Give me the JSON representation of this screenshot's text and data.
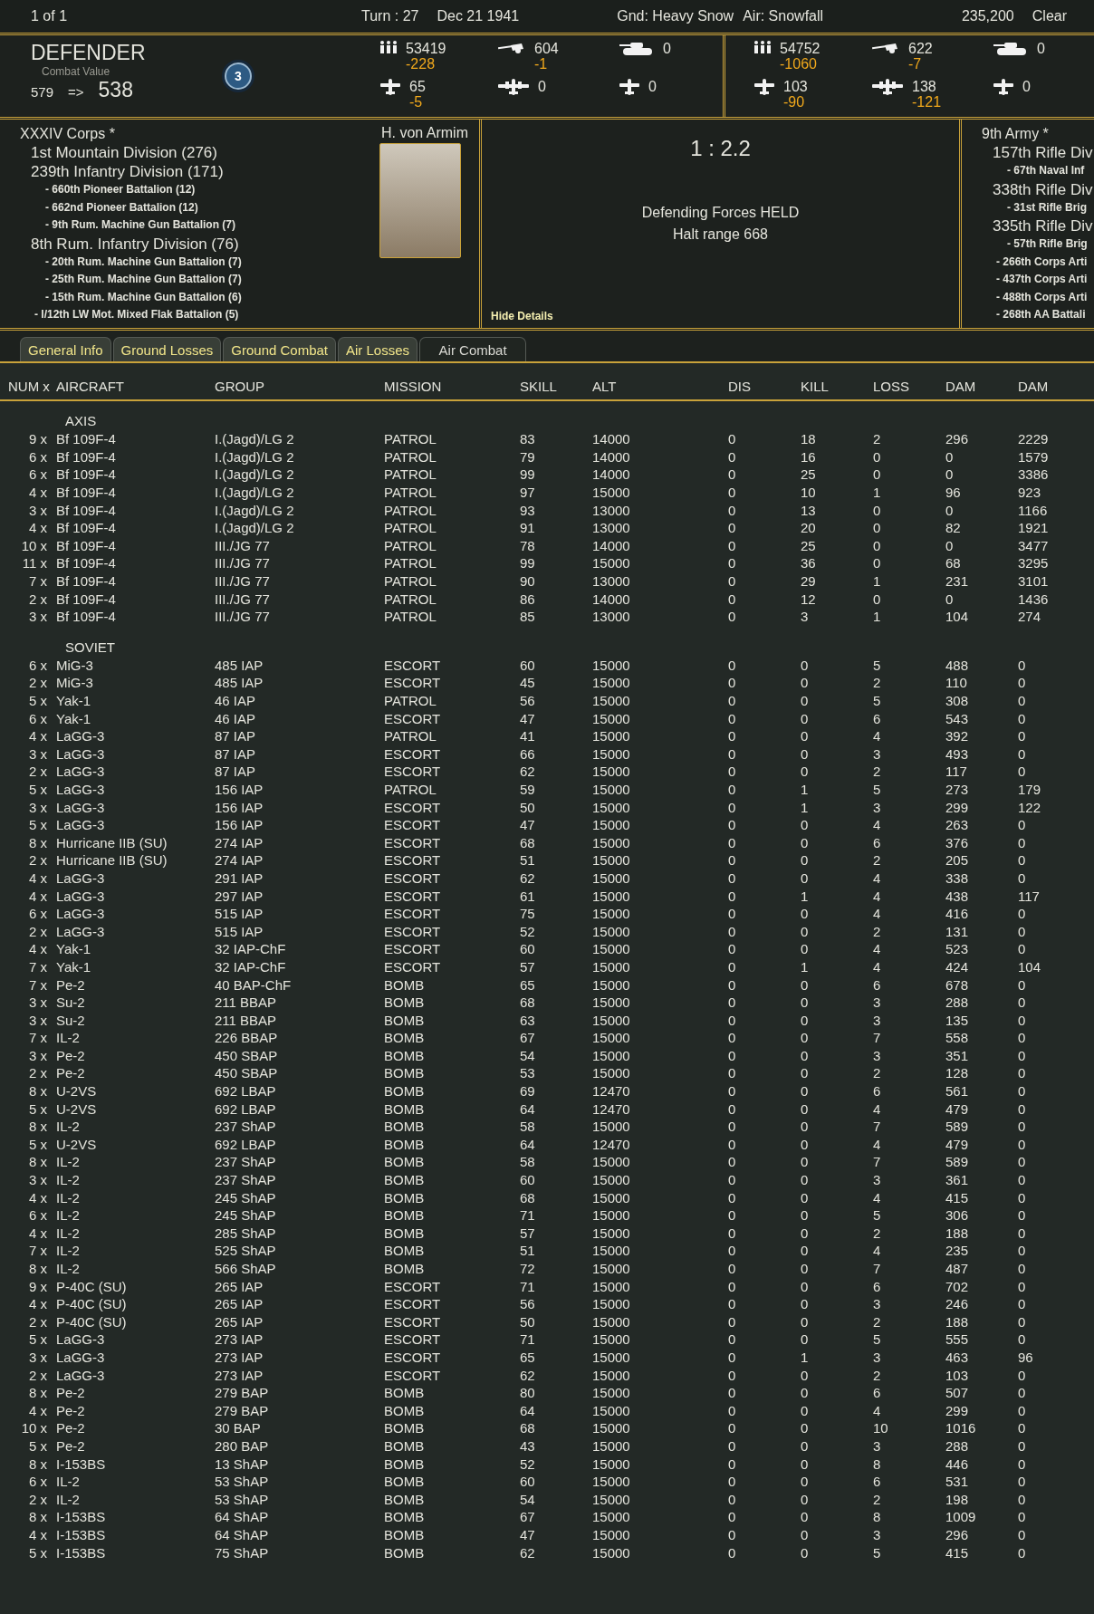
{
  "top_bar": {
    "page": "1 of 1",
    "turn": "Turn : 27",
    "date": "Dec 21 1941",
    "ground": "Gnd: Heavy Snow",
    "air": "Air: Snowfall",
    "score": "235,200",
    "weather": "Clear"
  },
  "defender": {
    "title": "DEFENDER",
    "cv_label": "Combat Value",
    "cv_from": "579",
    "arrow": "=>",
    "cv_to": "538",
    "badge": "3"
  },
  "sides": [
    {
      "stats": [
        {
          "kind": "men",
          "value": "53419",
          "loss": "-228"
        },
        {
          "kind": "gun",
          "value": "604",
          "loss": "-1"
        },
        {
          "kind": "tank",
          "value": "0"
        },
        {
          "kind": "fighter",
          "value": "65",
          "loss": "-5"
        },
        {
          "kind": "bomber",
          "value": "0"
        },
        {
          "kind": "fighter",
          "value": "0"
        }
      ]
    },
    {
      "stats": [
        {
          "kind": "men",
          "value": "54752",
          "loss": "-1060"
        },
        {
          "kind": "gun",
          "value": "622",
          "loss": "-7"
        },
        {
          "kind": "tank",
          "value": "0"
        },
        {
          "kind": "fighter",
          "value": "103",
          "loss": "-90"
        },
        {
          "kind": "bomber",
          "value": "138",
          "loss": "-121"
        },
        {
          "kind": "fighter",
          "value": "0"
        }
      ]
    }
  ],
  "left_force": {
    "commander": "H. von Armim",
    "units": [
      {
        "name": "XXXIV Corps *",
        "kind": "hq",
        "children": [
          {
            "name": "1st Mountain Division (276)",
            "kind": "division"
          },
          {
            "name": "239th Infantry Division (171)",
            "kind": "division",
            "children": [
              {
                "name": "- 660th Pioneer Battalion (12)",
                "kind": "battalion"
              },
              {
                "name": "- 662nd Pioneer Battalion (12)",
                "kind": "battalion"
              },
              {
                "name": "- 9th Rum. Machine Gun Battalion (7)",
                "kind": "battalion"
              }
            ]
          },
          {
            "name": "8th Rum. Infantry Division (76)",
            "kind": "division",
            "children": [
              {
                "name": "- 20th Rum. Machine Gun Battalion (7)",
                "kind": "battalion"
              },
              {
                "name": "- 25th Rum. Machine Gun Battalion (7)",
                "kind": "battalion"
              },
              {
                "name": "- 15th Rum. Machine Gun Battalion (6)",
                "kind": "battalion"
              }
            ]
          },
          {
            "name": "- I/12th LW Mot. Mixed Flak Battalion (5)",
            "kind": "battalion"
          }
        ]
      }
    ]
  },
  "result": {
    "odds": "1 : 2.2",
    "outcome": "Defending Forces HELD",
    "halt": "Halt range 668",
    "hide_link": "Hide Details"
  },
  "right_force": {
    "units": [
      {
        "name": "9th Army *",
        "kind": "hq",
        "children": [
          {
            "name": "157th Rifle Div",
            "kind": "division",
            "children": [
              {
                "name": "- 67th Naval Inf",
                "kind": "battalion"
              }
            ]
          },
          {
            "name": "338th Rifle Div",
            "kind": "division",
            "children": [
              {
                "name": "- 31st Rifle Brig",
                "kind": "battalion"
              }
            ]
          },
          {
            "name": "335th Rifle Div",
            "kind": "division",
            "children": [
              {
                "name": "- 57th Rifle Brig",
                "kind": "battalion"
              }
            ]
          },
          {
            "name": "- 266th Corps Arti",
            "kind": "battalion"
          },
          {
            "name": "- 437th Corps Arti",
            "kind": "battalion"
          },
          {
            "name": "- 488th Corps Arti",
            "kind": "battalion"
          },
          {
            "name": "- 268th AA Battali",
            "kind": "battalion"
          }
        ]
      }
    ]
  },
  "tabs": [
    {
      "label": "General Info",
      "selected": false
    },
    {
      "label": "Ground Losses",
      "selected": false
    },
    {
      "label": "Ground Combat",
      "selected": false
    },
    {
      "label": "Air Losses",
      "selected": false
    },
    {
      "label": "Air Combat",
      "selected": true
    }
  ],
  "table": {
    "columns": [
      "NUM x",
      "AIRCRAFT",
      "GROUP",
      "MISSION",
      "SKILL",
      "ALT",
      "DIS",
      "KILL",
      "LOSS",
      "DAM",
      "DAM"
    ],
    "sections": [
      {
        "title": "AXIS",
        "rows": [
          [
            "9 x",
            "Bf 109F-4",
            "I.(Jagd)/LG 2",
            "PATROL",
            "83",
            "14000",
            "0",
            "18",
            "2",
            "296",
            "2229"
          ],
          [
            "6 x",
            "Bf 109F-4",
            "I.(Jagd)/LG 2",
            "PATROL",
            "79",
            "14000",
            "0",
            "16",
            "0",
            "0",
            "1579"
          ],
          [
            "6 x",
            "Bf 109F-4",
            "I.(Jagd)/LG 2",
            "PATROL",
            "99",
            "14000",
            "0",
            "25",
            "0",
            "0",
            "3386"
          ],
          [
            "4 x",
            "Bf 109F-4",
            "I.(Jagd)/LG 2",
            "PATROL",
            "97",
            "15000",
            "0",
            "10",
            "1",
            "96",
            "923"
          ],
          [
            "3 x",
            "Bf 109F-4",
            "I.(Jagd)/LG 2",
            "PATROL",
            "93",
            "13000",
            "0",
            "13",
            "0",
            "0",
            "1166"
          ],
          [
            "4 x",
            "Bf 109F-4",
            "I.(Jagd)/LG 2",
            "PATROL",
            "91",
            "13000",
            "0",
            "20",
            "0",
            "82",
            "1921"
          ],
          [
            "10 x",
            "Bf 109F-4",
            "III./JG 77",
            "PATROL",
            "78",
            "14000",
            "0",
            "25",
            "0",
            "0",
            "3477"
          ],
          [
            "11 x",
            "Bf 109F-4",
            "III./JG 77",
            "PATROL",
            "99",
            "15000",
            "0",
            "36",
            "0",
            "68",
            "3295"
          ],
          [
            "7 x",
            "Bf 109F-4",
            "III./JG 77",
            "PATROL",
            "90",
            "13000",
            "0",
            "29",
            "1",
            "231",
            "3101"
          ],
          [
            "2 x",
            "Bf 109F-4",
            "III./JG 77",
            "PATROL",
            "86",
            "14000",
            "0",
            "12",
            "0",
            "0",
            "1436"
          ],
          [
            "3 x",
            "Bf 109F-4",
            "III./JG 77",
            "PATROL",
            "85",
            "13000",
            "0",
            "3",
            "1",
            "104",
            "274"
          ]
        ]
      },
      {
        "title": "SOVIET",
        "rows": [
          [
            "6 x",
            "MiG-3",
            "485 IAP",
            "ESCORT",
            "60",
            "15000",
            "0",
            "0",
            "5",
            "488",
            "0"
          ],
          [
            "2 x",
            "MiG-3",
            "485 IAP",
            "ESCORT",
            "45",
            "15000",
            "0",
            "0",
            "2",
            "110",
            "0"
          ],
          [
            "5 x",
            "Yak-1",
            "46 IAP",
            "PATROL",
            "56",
            "15000",
            "0",
            "0",
            "5",
            "308",
            "0"
          ],
          [
            "6 x",
            "Yak-1",
            "46 IAP",
            "ESCORT",
            "47",
            "15000",
            "0",
            "0",
            "6",
            "543",
            "0"
          ],
          [
            "4 x",
            "LaGG-3",
            "87 IAP",
            "PATROL",
            "41",
            "15000",
            "0",
            "0",
            "4",
            "392",
            "0"
          ],
          [
            "3 x",
            "LaGG-3",
            "87 IAP",
            "ESCORT",
            "66",
            "15000",
            "0",
            "0",
            "3",
            "493",
            "0"
          ],
          [
            "2 x",
            "LaGG-3",
            "87 IAP",
            "ESCORT",
            "62",
            "15000",
            "0",
            "0",
            "2",
            "117",
            "0"
          ],
          [
            "5 x",
            "LaGG-3",
            "156 IAP",
            "PATROL",
            "59",
            "15000",
            "0",
            "1",
            "5",
            "273",
            "179"
          ],
          [
            "3 x",
            "LaGG-3",
            "156 IAP",
            "ESCORT",
            "50",
            "15000",
            "0",
            "1",
            "3",
            "299",
            "122"
          ],
          [
            "5 x",
            "LaGG-3",
            "156 IAP",
            "ESCORT",
            "47",
            "15000",
            "0",
            "0",
            "4",
            "263",
            "0"
          ],
          [
            "8 x",
            "Hurricane IIB (SU)",
            "274 IAP",
            "ESCORT",
            "68",
            "15000",
            "0",
            "0",
            "6",
            "376",
            "0"
          ],
          [
            "2 x",
            "Hurricane IIB (SU)",
            "274 IAP",
            "ESCORT",
            "51",
            "15000",
            "0",
            "0",
            "2",
            "205",
            "0"
          ],
          [
            "4 x",
            "LaGG-3",
            "291 IAP",
            "ESCORT",
            "62",
            "15000",
            "0",
            "0",
            "4",
            "338",
            "0"
          ],
          [
            "4 x",
            "LaGG-3",
            "297 IAP",
            "ESCORT",
            "61",
            "15000",
            "0",
            "1",
            "4",
            "438",
            "117"
          ],
          [
            "6 x",
            "LaGG-3",
            "515 IAP",
            "ESCORT",
            "75",
            "15000",
            "0",
            "0",
            "4",
            "416",
            "0"
          ],
          [
            "2 x",
            "LaGG-3",
            "515 IAP",
            "ESCORT",
            "52",
            "15000",
            "0",
            "0",
            "2",
            "131",
            "0"
          ],
          [
            "4 x",
            "Yak-1",
            "32 IAP-ChF",
            "ESCORT",
            "60",
            "15000",
            "0",
            "0",
            "4",
            "523",
            "0"
          ],
          [
            "7 x",
            "Yak-1",
            "32 IAP-ChF",
            "ESCORT",
            "57",
            "15000",
            "0",
            "1",
            "4",
            "424",
            "104"
          ],
          [
            "7 x",
            "Pe-2",
            "40 BAP-ChF",
            "BOMB",
            "65",
            "15000",
            "0",
            "0",
            "6",
            "678",
            "0"
          ],
          [
            "3 x",
            "Su-2",
            "211 BBAP",
            "BOMB",
            "68",
            "15000",
            "0",
            "0",
            "3",
            "288",
            "0"
          ],
          [
            "3 x",
            "Su-2",
            "211 BBAP",
            "BOMB",
            "63",
            "15000",
            "0",
            "0",
            "3",
            "135",
            "0"
          ],
          [
            "7 x",
            "IL-2",
            "226 BBAP",
            "BOMB",
            "67",
            "15000",
            "0",
            "0",
            "7",
            "558",
            "0"
          ],
          [
            "3 x",
            "Pe-2",
            "450 SBAP",
            "BOMB",
            "54",
            "15000",
            "0",
            "0",
            "3",
            "351",
            "0"
          ],
          [
            "2 x",
            "Pe-2",
            "450 SBAP",
            "BOMB",
            "53",
            "15000",
            "0",
            "0",
            "2",
            "128",
            "0"
          ],
          [
            "8 x",
            "U-2VS",
            "692 LBAP",
            "BOMB",
            "69",
            "12470",
            "0",
            "0",
            "6",
            "561",
            "0"
          ],
          [
            "5 x",
            "U-2VS",
            "692 LBAP",
            "BOMB",
            "64",
            "12470",
            "0",
            "0",
            "4",
            "479",
            "0"
          ],
          [
            "8 x",
            "IL-2",
            "237 ShAP",
            "BOMB",
            "58",
            "15000",
            "0",
            "0",
            "7",
            "589",
            "0"
          ],
          [
            "5 x",
            "U-2VS",
            "692 LBAP",
            "BOMB",
            "64",
            "12470",
            "0",
            "0",
            "4",
            "479",
            "0"
          ],
          [
            "8 x",
            "IL-2",
            "237 ShAP",
            "BOMB",
            "58",
            "15000",
            "0",
            "0",
            "7",
            "589",
            "0"
          ],
          [
            "3 x",
            "IL-2",
            "237 ShAP",
            "BOMB",
            "60",
            "15000",
            "0",
            "0",
            "3",
            "361",
            "0"
          ],
          [
            "4 x",
            "IL-2",
            "245 ShAP",
            "BOMB",
            "68",
            "15000",
            "0",
            "0",
            "4",
            "415",
            "0"
          ],
          [
            "6 x",
            "IL-2",
            "245 ShAP",
            "BOMB",
            "71",
            "15000",
            "0",
            "0",
            "5",
            "306",
            "0"
          ],
          [
            "4 x",
            "IL-2",
            "285 ShAP",
            "BOMB",
            "57",
            "15000",
            "0",
            "0",
            "2",
            "188",
            "0"
          ],
          [
            "7 x",
            "IL-2",
            "525 ShAP",
            "BOMB",
            "51",
            "15000",
            "0",
            "0",
            "4",
            "235",
            "0"
          ],
          [
            "8 x",
            "IL-2",
            "566 ShAP",
            "BOMB",
            "72",
            "15000",
            "0",
            "0",
            "7",
            "487",
            "0"
          ],
          [
            "9 x",
            "P-40C (SU)",
            "265 IAP",
            "ESCORT",
            "71",
            "15000",
            "0",
            "0",
            "6",
            "702",
            "0"
          ],
          [
            "4 x",
            "P-40C (SU)",
            "265 IAP",
            "ESCORT",
            "56",
            "15000",
            "0",
            "0",
            "3",
            "246",
            "0"
          ],
          [
            "2 x",
            "P-40C (SU)",
            "265 IAP",
            "ESCORT",
            "50",
            "15000",
            "0",
            "0",
            "2",
            "188",
            "0"
          ],
          [
            "5 x",
            "LaGG-3",
            "273 IAP",
            "ESCORT",
            "71",
            "15000",
            "0",
            "0",
            "5",
            "555",
            "0"
          ],
          [
            "3 x",
            "LaGG-3",
            "273 IAP",
            "ESCORT",
            "65",
            "15000",
            "0",
            "1",
            "3",
            "463",
            "96"
          ],
          [
            "2 x",
            "LaGG-3",
            "273 IAP",
            "ESCORT",
            "62",
            "15000",
            "0",
            "0",
            "2",
            "103",
            "0"
          ],
          [
            "8 x",
            "Pe-2",
            "279 BAP",
            "BOMB",
            "80",
            "15000",
            "0",
            "0",
            "6",
            "507",
            "0"
          ],
          [
            "4 x",
            "Pe-2",
            "279 BAP",
            "BOMB",
            "64",
            "15000",
            "0",
            "0",
            "4",
            "299",
            "0"
          ],
          [
            "10 x",
            "Pe-2",
            "30 BAP",
            "BOMB",
            "68",
            "15000",
            "0",
            "0",
            "10",
            "1016",
            "0"
          ],
          [
            "5 x",
            "Pe-2",
            "280 BAP",
            "BOMB",
            "43",
            "15000",
            "0",
            "0",
            "3",
            "288",
            "0"
          ],
          [
            "8 x",
            "I-153BS",
            "13 ShAP",
            "BOMB",
            "52",
            "15000",
            "0",
            "0",
            "8",
            "446",
            "0"
          ],
          [
            "6 x",
            "IL-2",
            "53 ShAP",
            "BOMB",
            "60",
            "15000",
            "0",
            "0",
            "6",
            "531",
            "0"
          ],
          [
            "2 x",
            "IL-2",
            "53 ShAP",
            "BOMB",
            "54",
            "15000",
            "0",
            "0",
            "2",
            "198",
            "0"
          ],
          [
            "8 x",
            "I-153BS",
            "64 ShAP",
            "BOMB",
            "67",
            "15000",
            "0",
            "0",
            "8",
            "1009",
            "0"
          ],
          [
            "4 x",
            "I-153BS",
            "64 ShAP",
            "BOMB",
            "47",
            "15000",
            "0",
            "0",
            "3",
            "296",
            "0"
          ],
          [
            "5 x",
            "I-153BS",
            "75 ShAP",
            "BOMB",
            "62",
            "15000",
            "0",
            "0",
            "5",
            "415",
            "0"
          ]
        ]
      }
    ]
  }
}
